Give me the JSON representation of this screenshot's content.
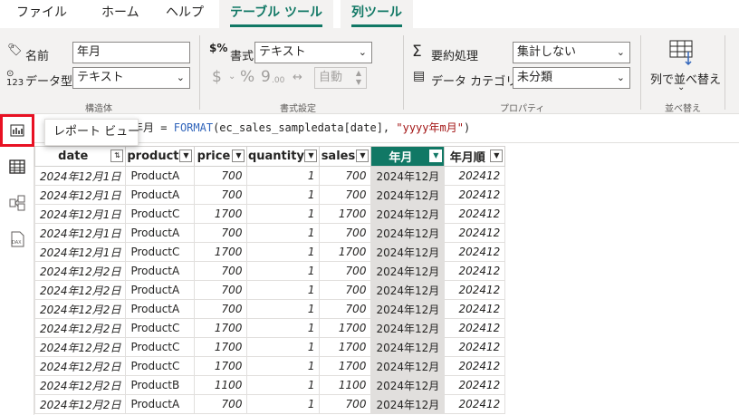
{
  "menu": {
    "tabs": [
      "ファイル",
      "ホーム",
      "ヘルプ",
      "テーブル ツール",
      "列ツール"
    ]
  },
  "ribbon": {
    "structure": {
      "name_label": "名前",
      "name_value": "年月",
      "datatype_label": "データ型",
      "datatype_value": "テキスト",
      "group_label": "構造体"
    },
    "format": {
      "format_label": "書式",
      "format_value": "テキスト",
      "currency_symbol": "$",
      "percent_symbol": "%",
      "comma_symbol": "9",
      "decimal_symbol": ".00",
      "auto_value": "自動",
      "group_label": "書式設定"
    },
    "properties": {
      "summary_label": "要約処理",
      "summary_value": "集計しない",
      "category_label": "データ カテゴリ",
      "category_value": "未分類",
      "group_label": "プロパティ"
    },
    "sort": {
      "sort_by_column_label": "列で並べ替え",
      "group_label": "並べ替え"
    }
  },
  "rail": {
    "tooltip": "レポート ビュー"
  },
  "formula": {
    "name": "年月",
    "op": "=",
    "func": "FORMAT",
    "args_open": "(ec_sales_sampledata[date], ",
    "format_string": "\"yyyy年m月\"",
    "close": ")"
  },
  "table": {
    "columns": [
      "date",
      "product",
      "price",
      "quantity",
      "sales",
      "年月",
      "年月順"
    ],
    "selected_column": "年月",
    "rows": [
      [
        "2024年12月1日",
        "ProductA",
        "700",
        "1",
        "700",
        "2024年12月",
        "202412"
      ],
      [
        "2024年12月1日",
        "ProductA",
        "700",
        "1",
        "700",
        "2024年12月",
        "202412"
      ],
      [
        "2024年12月1日",
        "ProductC",
        "1700",
        "1",
        "1700",
        "2024年12月",
        "202412"
      ],
      [
        "2024年12月1日",
        "ProductA",
        "700",
        "1",
        "700",
        "2024年12月",
        "202412"
      ],
      [
        "2024年12月1日",
        "ProductC",
        "1700",
        "1",
        "1700",
        "2024年12月",
        "202412"
      ],
      [
        "2024年12月2日",
        "ProductA",
        "700",
        "1",
        "700",
        "2024年12月",
        "202412"
      ],
      [
        "2024年12月2日",
        "ProductA",
        "700",
        "1",
        "700",
        "2024年12月",
        "202412"
      ],
      [
        "2024年12月2日",
        "ProductA",
        "700",
        "1",
        "700",
        "2024年12月",
        "202412"
      ],
      [
        "2024年12月2日",
        "ProductC",
        "1700",
        "1",
        "1700",
        "2024年12月",
        "202412"
      ],
      [
        "2024年12月2日",
        "ProductC",
        "1700",
        "1",
        "1700",
        "2024年12月",
        "202412"
      ],
      [
        "2024年12月2日",
        "ProductC",
        "1700",
        "1",
        "1700",
        "2024年12月",
        "202412"
      ],
      [
        "2024年12月2日",
        "ProductB",
        "1100",
        "1",
        "1100",
        "2024年12月",
        "202412"
      ],
      [
        "2024年12月2日",
        "ProductA",
        "700",
        "1",
        "700",
        "2024年12月",
        "202412"
      ]
    ]
  },
  "colors": {
    "accent": "#117865",
    "highlight_box": "#e81123"
  },
  "icons": {
    "report_view": "bar-chart-icon",
    "table_view": "table-icon",
    "model_view": "model-icon",
    "dax_query": "dax-icon"
  }
}
